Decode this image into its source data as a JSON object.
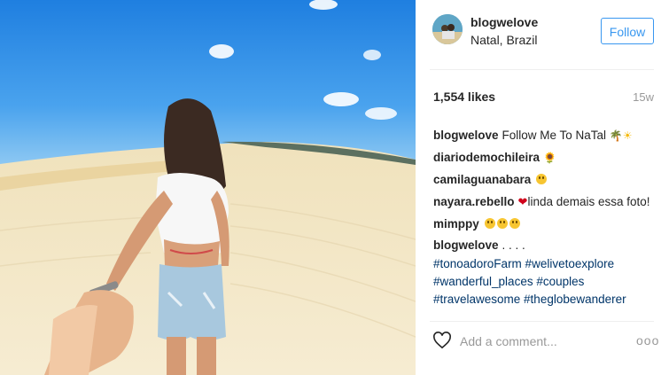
{
  "post": {
    "username": "blogwelove",
    "location": "Natal, Brazil",
    "follow_label": "Follow",
    "likes": "1,554 likes",
    "age": "15w",
    "caption": "Follow Me To NaTal",
    "comments": [
      {
        "user": "diariodemochileira",
        "text": ""
      },
      {
        "user": "camilaguanabara",
        "text": ""
      },
      {
        "user": "nayara.rebello",
        "text": "linda demais essa foto!"
      },
      {
        "user": "mimppy",
        "text": ""
      }
    ],
    "last_comment": {
      "user": "blogwelove",
      "text": ". . . .",
      "tags": [
        "#tonoadoroFarm #welivetoexplore",
        "#wanderful_places #couples",
        "#travelawesome #theglobewanderer"
      ]
    },
    "comment_placeholder": "Add a comment...",
    "more_label": "ooo"
  },
  "icons": {
    "like": "heart-outline-icon",
    "more": "more-options-icon"
  },
  "colors": {
    "accent": "#3897f0",
    "hashtag": "#003569",
    "heart": "#d0021b"
  }
}
